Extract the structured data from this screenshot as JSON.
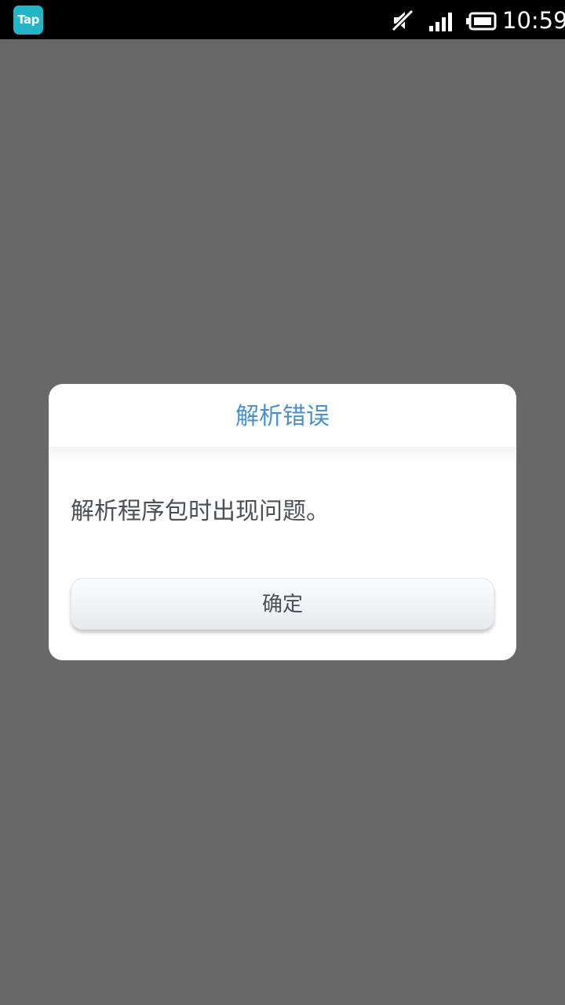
{
  "status_bar": {
    "app_badge_label": "Tap",
    "app_badge_color": "#21b5c6",
    "icons": [
      "mute-icon",
      "signal-icon",
      "battery-icon"
    ],
    "time": "10:59"
  },
  "dialog": {
    "title": "解析错误",
    "message": "解析程序包时出现问题。",
    "ok_label": "确定",
    "title_color": "#4a8fcb"
  }
}
